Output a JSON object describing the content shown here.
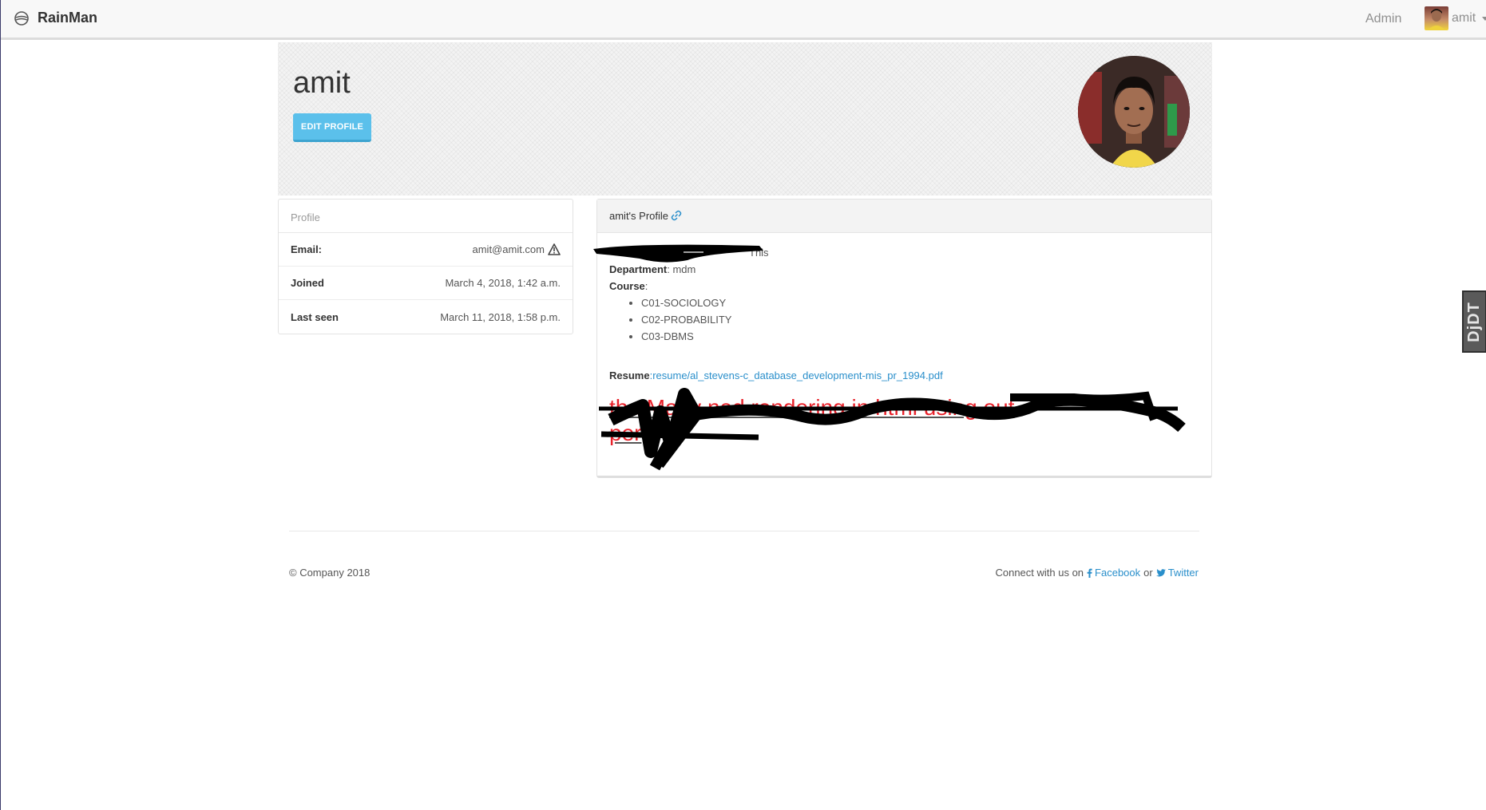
{
  "navbar": {
    "brand": "RainMan",
    "admin_link": "Admin",
    "username": "amit"
  },
  "header": {
    "name": "amit",
    "edit_button": "EDIT PROFILE"
  },
  "info_panel": {
    "title": "Profile",
    "rows": [
      {
        "label": "Email:",
        "value": "amit@amit.com"
      },
      {
        "label": "Joined",
        "value": "March 4, 2018, 1:42 a.m."
      },
      {
        "label": "Last seen",
        "value": "March 11, 2018, 1:58 p.m."
      }
    ]
  },
  "profile_panel": {
    "title": "amit's Profile",
    "partial_line": "This",
    "department_label": "Department",
    "department_value": ": mdm",
    "course_label": "Course",
    "course_colon": ":",
    "courses": [
      "C01-SOCIOLOGY",
      "C02-PROBABILITY",
      "C03-DBMS"
    ],
    "resume_label": "Resume",
    "resume_colon": ":",
    "resume_link": "resume/al_stevens-c_database_development-mis_pr_1994.pdf",
    "red_text_line1": "the Many ned rendering in html using",
    "red_text_suffix": "out",
    "red_text_line2": "per",
    "colors": {
      "red_text": "#e8212a",
      "link": "#2a8fcb"
    }
  },
  "footer": {
    "copyright": "© Company 2018",
    "connect_prefix": "Connect with us on",
    "facebook": "Facebook",
    "or": "or",
    "twitter": "Twitter"
  },
  "side_widget": {
    "label": "DjDT"
  },
  "icons": {
    "brand": "globe-icon",
    "warning": "warning-icon",
    "link": "link-icon",
    "facebook": "facebook-icon",
    "twitter": "twitter-icon",
    "caret": "chevron-down-icon"
  }
}
